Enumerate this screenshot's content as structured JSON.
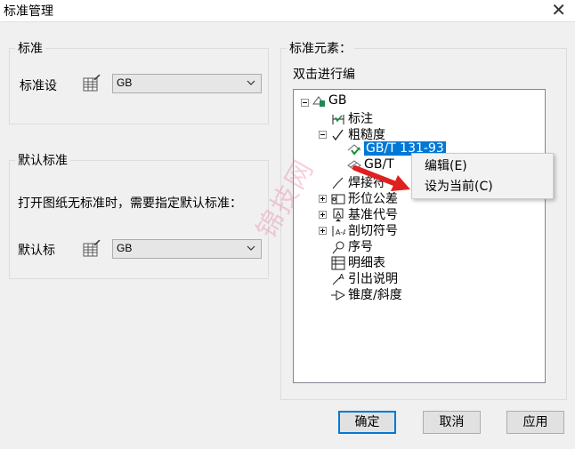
{
  "window": {
    "title": "标准管理",
    "close": "✕"
  },
  "standard_group": {
    "legend": "标准",
    "label": "标准设",
    "value": "GB"
  },
  "default_group": {
    "legend": "默认标准",
    "message": "打开图纸无标准时，需要指定默认标准：",
    "label": "默认标",
    "value": "GB"
  },
  "elements_group": {
    "legend": "标准元素：",
    "hint": "双击进行编"
  },
  "tree": {
    "root": "GB",
    "items": [
      {
        "label": "标注"
      },
      {
        "label": "粗糙度"
      },
      {
        "label": "GB/T 131-93"
      },
      {
        "label": "GB/T"
      },
      {
        "label": "焊接符"
      },
      {
        "label": "形位公差"
      },
      {
        "label": "基准代号"
      },
      {
        "label": "剖切符号"
      },
      {
        "label": "序号"
      },
      {
        "label": "明细表"
      },
      {
        "label": "引出说明"
      },
      {
        "label": "锥度/斜度"
      }
    ]
  },
  "context_menu": {
    "edit": "编辑(E)",
    "set_current": "设为当前(C)"
  },
  "buttons": {
    "ok": "确定",
    "cancel": "取消",
    "apply": "应用"
  },
  "watermark": "锦技网",
  "colors": {
    "selection": "#0078d7",
    "arrow": "#e02020"
  }
}
